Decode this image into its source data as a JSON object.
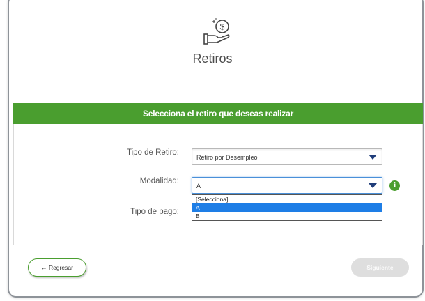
{
  "header": {
    "icon": "hand-coin-icon",
    "coin_symbol": "$",
    "title": "Retiros"
  },
  "panel": {
    "header": "Selecciona el retiro que deseas realizar"
  },
  "form": {
    "tipo_retiro": {
      "label": "Tipo de Retiro:",
      "value": "Retiro por Desempleo"
    },
    "modalidad": {
      "label": "Modalidad:",
      "value": "A",
      "options": [
        "[Selecciona]",
        "A",
        "B"
      ],
      "highlighted_option": "A",
      "info_icon": "i"
    },
    "tipo_pago": {
      "label": "Tipo de pago:"
    }
  },
  "footer": {
    "back_label": "← Regresar",
    "next_label": "Siguiente"
  },
  "colors": {
    "accent_green": "#4a9e2f",
    "caret_blue": "#1f3d7a",
    "option_highlight": "#1e7ee6",
    "disabled_button": "#dedede"
  }
}
